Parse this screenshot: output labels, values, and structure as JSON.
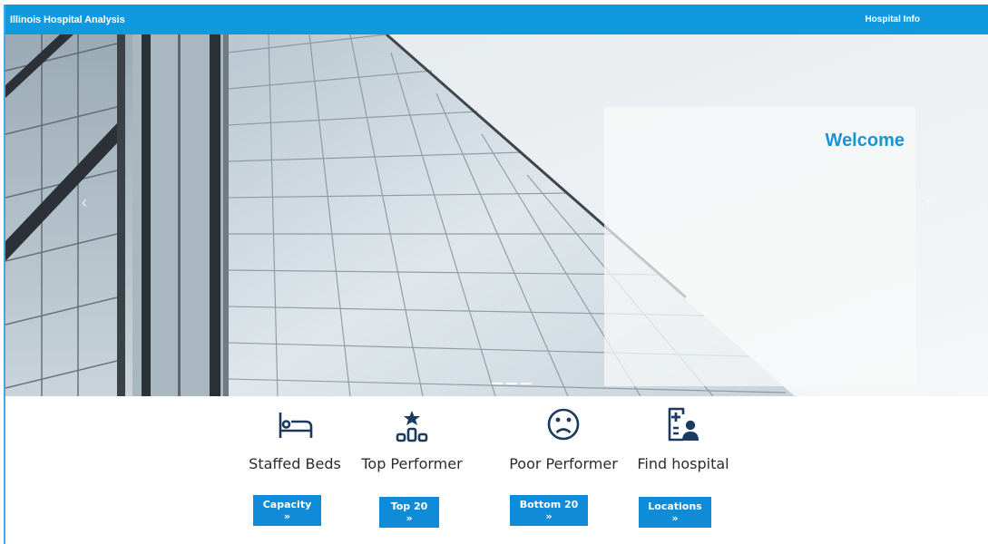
{
  "navbar": {
    "brand": "Illinois Hospital Analysis",
    "link": "Hospital Info"
  },
  "hero": {
    "welcome": "Welcome",
    "prev": "‹",
    "next": "›"
  },
  "features": [
    {
      "icon": "bed-icon",
      "label": "Staffed Beds",
      "button": "Capacity »"
    },
    {
      "icon": "ranking-podium-star-icon",
      "label": "Top Performer",
      "button": "Top 20 »"
    },
    {
      "icon": "sad-face-icon",
      "label": "Poor Performer",
      "button": "Bottom 20 »"
    },
    {
      "icon": "hospital-person-icon",
      "label": "Find hospital",
      "button": "Locations »"
    }
  ],
  "colors": {
    "primary": "#0f9ae0",
    "button": "#0f8bd8",
    "welcome": "#1a95d4",
    "icon": "#1c3a5e"
  }
}
